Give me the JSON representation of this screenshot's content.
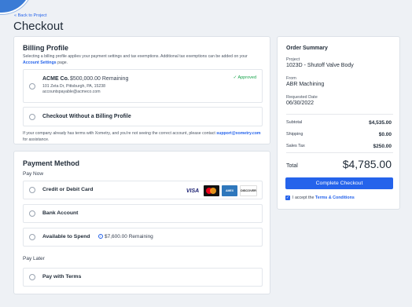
{
  "nav": {
    "back_link": "« Back to Project"
  },
  "page": {
    "title": "Checkout"
  },
  "billing": {
    "title": "Billing Profile",
    "description_prefix": "Selecting a billing profile applies your payment settings and tax exemptions. Additional tax exemptions can be added on your ",
    "description_link": "Account Settings",
    "description_suffix": " page.",
    "profiles": [
      {
        "name": "ACME Co.",
        "remaining": "$500,000.00 Remaining",
        "address_line1": "101 Zeta Dr, Pittsburgh, PA, 15238",
        "email": "accountspayable@acmeco.com",
        "status": "Approved"
      }
    ],
    "no_profile_label": "Checkout Without a Billing Profile",
    "help_prefix": "If your company already has terms with Xometry, and you're not seeing the correct account, please contact ",
    "help_link": "support@xometry.com",
    "help_suffix": " for assistance."
  },
  "payment": {
    "title": "Payment Method",
    "pay_now_label": "Pay Now",
    "options": [
      {
        "label": "Credit or Debit Card"
      },
      {
        "label": "Bank Account"
      },
      {
        "label": "Available to Spend",
        "amount": "$7,600.00 Remaining"
      }
    ],
    "card_logos": [
      "VISA",
      "mastercard",
      "AMERICAN EXPRESS",
      "DISCOVER"
    ],
    "pay_later_label": "Pay Later",
    "later_options": [
      {
        "label": "Pay with Terms"
      }
    ]
  },
  "summary": {
    "title": "Order Summary",
    "project_label": "Project",
    "project_value": "1023D - Shutoff Valve Body",
    "from_label": "From",
    "from_value": "ABR Machining",
    "date_label": "Requested Date",
    "date_value": "06/30/2022",
    "lines": [
      {
        "label": "Subtotal",
        "value": "$4,535.00"
      },
      {
        "label": "Shipping",
        "value": "$0.00"
      },
      {
        "label": "Sales Tax",
        "value": "$250.00"
      }
    ],
    "total_label": "Total",
    "total_value": "$4,785.00",
    "checkout_button": "Complete Checkout",
    "terms_prefix": "I accept the ",
    "terms_link": "Terms & Conditions"
  },
  "colors": {
    "accent": "#2563eb",
    "approved": "#16a34a",
    "background": "#eef1f5"
  }
}
